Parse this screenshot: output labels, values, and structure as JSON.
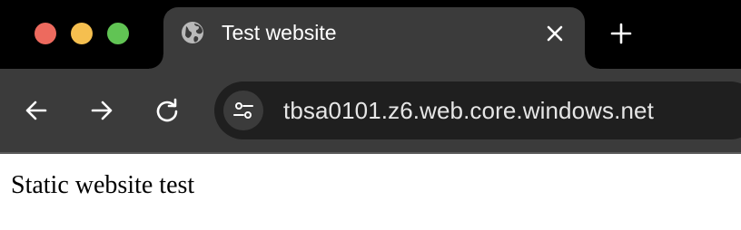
{
  "window": {
    "controls": [
      {
        "name": "close",
        "color": "#ed6a5e"
      },
      {
        "name": "minimize",
        "color": "#f5bf4f"
      },
      {
        "name": "zoom",
        "color": "#61c454"
      }
    ]
  },
  "tab": {
    "title": "Test website",
    "icon": "globe-icon",
    "close_icon": "close-icon"
  },
  "new_tab_icon": "plus-icon",
  "toolbar": {
    "back_icon": "arrow-left-icon",
    "forward_icon": "arrow-right-icon",
    "reload_icon": "reload-icon",
    "site_info_icon": "tune-icon",
    "url": "tbsa0101.z6.web.core.windows.net"
  },
  "page": {
    "body_text": "Static website test"
  },
  "colors": {
    "tabbar_bg": "#000000",
    "toolbar_bg": "#3b3b3b",
    "omnibox_bg": "#1f1f1f",
    "page_bg": "#ffffff"
  }
}
